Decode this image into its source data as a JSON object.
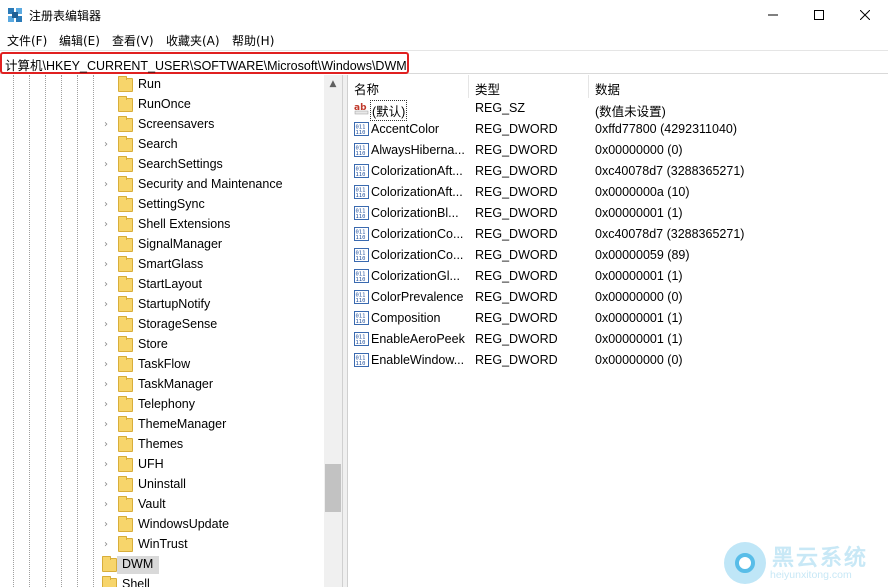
{
  "window": {
    "title": "注册表编辑器",
    "controls": {
      "minimize": "minimize-icon",
      "maximize": "maximize-icon",
      "close": "close-icon"
    }
  },
  "menu": {
    "items": [
      "文件(F)",
      "编辑(E)",
      "查看(V)",
      "收藏夹(A)",
      "帮助(H)"
    ]
  },
  "address": {
    "path": "计算机\\HKEY_CURRENT_USER\\SOFTWARE\\Microsoft\\Windows\\DWM",
    "highlight_color": "#e02020"
  },
  "tree": {
    "items": [
      "Run",
      "RunOnce",
      "Screensavers",
      "Search",
      "SearchSettings",
      "Security and Maintenance",
      "SettingSync",
      "Shell Extensions",
      "SignalManager",
      "SmartGlass",
      "StartLayout",
      "StartupNotify",
      "StorageSense",
      "Store",
      "TaskFlow",
      "TaskManager",
      "Telephony",
      "ThemeManager",
      "Themes",
      "UFH",
      "Uninstall",
      "Vault",
      "WindowsUpdate",
      "WinTrust"
    ],
    "selected": "DWM",
    "partial": "Shell"
  },
  "values": {
    "headers": {
      "name": "名称",
      "type": "类型",
      "data": "数据"
    },
    "rows": [
      {
        "icon": "string-value-icon",
        "name": "(默认)",
        "type": "REG_SZ",
        "data": "(数值未设置)"
      },
      {
        "icon": "dword-value-icon",
        "name": "AccentColor",
        "type": "REG_DWORD",
        "data": "0xffd77800 (4292311040)"
      },
      {
        "icon": "dword-value-icon",
        "name": "AlwaysHiberna...",
        "type": "REG_DWORD",
        "data": "0x00000000 (0)"
      },
      {
        "icon": "dword-value-icon",
        "name": "ColorizationAft...",
        "type": "REG_DWORD",
        "data": "0xc40078d7 (3288365271)"
      },
      {
        "icon": "dword-value-icon",
        "name": "ColorizationAft...",
        "type": "REG_DWORD",
        "data": "0x0000000a (10)"
      },
      {
        "icon": "dword-value-icon",
        "name": "ColorizationBl...",
        "type": "REG_DWORD",
        "data": "0x00000001 (1)"
      },
      {
        "icon": "dword-value-icon",
        "name": "ColorizationCo...",
        "type": "REG_DWORD",
        "data": "0xc40078d7 (3288365271)"
      },
      {
        "icon": "dword-value-icon",
        "name": "ColorizationCo...",
        "type": "REG_DWORD",
        "data": "0x00000059 (89)"
      },
      {
        "icon": "dword-value-icon",
        "name": "ColorizationGl...",
        "type": "REG_DWORD",
        "data": "0x00000001 (1)"
      },
      {
        "icon": "dword-value-icon",
        "name": "ColorPrevalence",
        "type": "REG_DWORD",
        "data": "0x00000000 (0)"
      },
      {
        "icon": "dword-value-icon",
        "name": "Composition",
        "type": "REG_DWORD",
        "data": "0x00000001 (1)"
      },
      {
        "icon": "dword-value-icon",
        "name": "EnableAeroPeek",
        "type": "REG_DWORD",
        "data": "0x00000001 (1)"
      },
      {
        "icon": "dword-value-icon",
        "name": "EnableWindow...",
        "type": "REG_DWORD",
        "data": "0x00000000 (0)"
      }
    ]
  },
  "watermark": {
    "brand": "黑云系统",
    "url": "heiyunxitong.com"
  }
}
